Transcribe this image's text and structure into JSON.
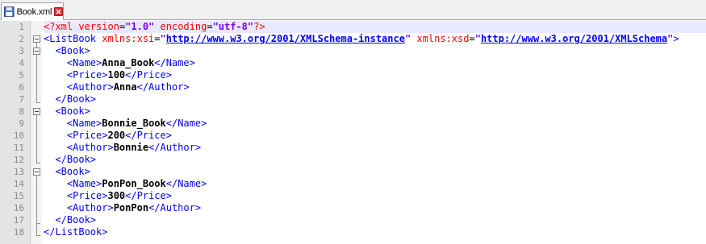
{
  "tab": {
    "title": "Book.xml",
    "file_icon": "save-disk-icon",
    "close_icon": "close-icon"
  },
  "gutter": {
    "line_numbers": [
      "1",
      "2",
      "3",
      "4",
      "5",
      "6",
      "7",
      "8",
      "9",
      "10",
      "11",
      "12",
      "13",
      "14",
      "15",
      "16",
      "17",
      "18"
    ]
  },
  "code": {
    "line1": {
      "open": "<?xml ",
      "a1": "version",
      "eq1": "=",
      "v1": "\"1.0\"",
      "sp": " ",
      "a2": "encoding",
      "eq2": "=",
      "v2": "\"utf-8\"",
      "close": "?>"
    },
    "line2": {
      "open": "<ListBook ",
      "a1": "xmlns:xsi",
      "eq1": "=",
      "q1": "\"",
      "url1": "http://www.w3.org/2001/XMLSchema-instance",
      "q1e": "\"",
      "sp": " ",
      "a2": "xmlns:xsd",
      "eq2": "=",
      "q2": "\"",
      "url2": "http://www.w3.org/2001/XMLSchema",
      "q2e": "\"",
      "close": ">"
    },
    "books": [
      {
        "name": "Anna_Book",
        "price": "100",
        "author": "Anna"
      },
      {
        "name": "Bonnie_Book",
        "price": "200",
        "author": "Bonnie"
      },
      {
        "name": "PonPon_Book",
        "price": "300",
        "author": "PonPon"
      }
    ],
    "tags": {
      "book_open": "<Book>",
      "book_close": "</Book>",
      "name_open": "<Name>",
      "name_close": "</Name>",
      "price_open": "<Price>",
      "price_close": "</Price>",
      "author_open": "<Author>",
      "author_close": "</Author>",
      "listbook_close": "</ListBook>"
    }
  },
  "colors": {
    "tag": "#0000ff",
    "text": "#000000",
    "attribute": "#ff0000",
    "value": "#8000ff",
    "active_line": "#e8e8ff"
  }
}
